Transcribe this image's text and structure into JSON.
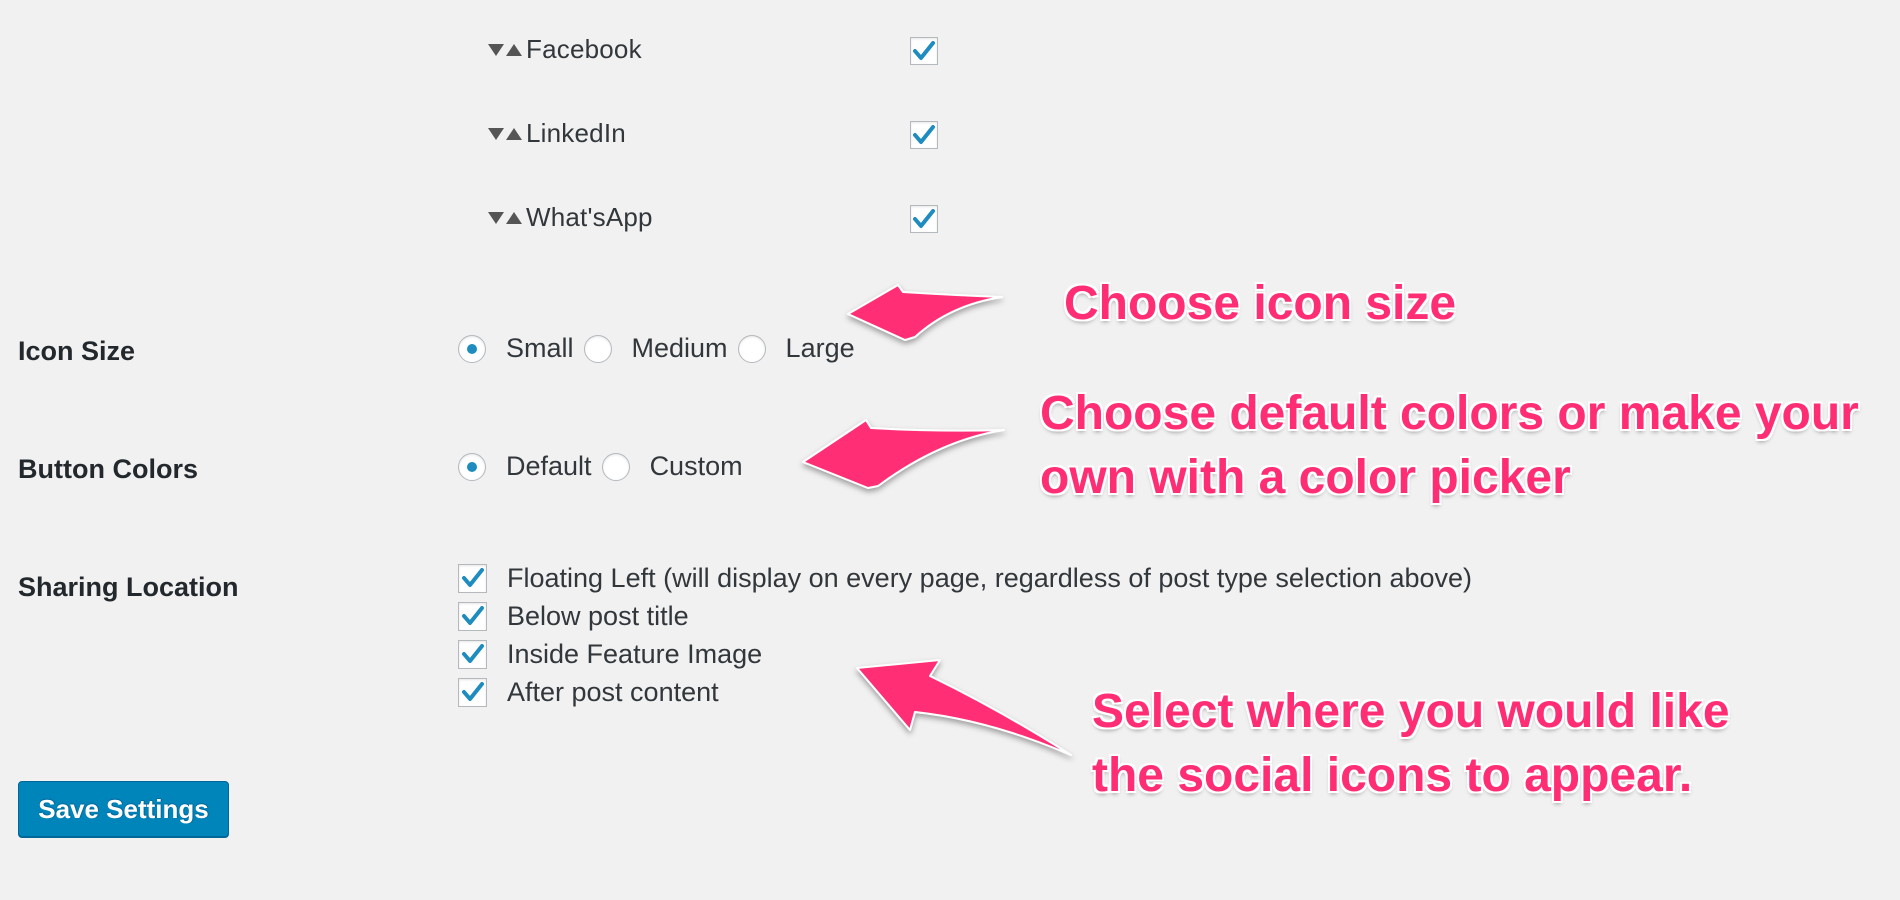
{
  "networks": [
    {
      "label": "Facebook",
      "checked": true
    },
    {
      "label": "LinkedIn",
      "checked": true
    },
    {
      "label": "What'sApp",
      "checked": true
    }
  ],
  "icon_size": {
    "label": "Icon Size",
    "options": [
      "Small",
      "Medium",
      "Large"
    ],
    "selected": "Small"
  },
  "button_colors": {
    "label": "Button Colors",
    "options": [
      "Default",
      "Custom"
    ],
    "selected": "Default"
  },
  "sharing_location": {
    "label": "Sharing Location",
    "options": [
      {
        "label": "Floating Left (will display on every page, regardless of post type selection above)",
        "checked": true
      },
      {
        "label": "Below post title",
        "checked": true
      },
      {
        "label": "Inside Feature Image",
        "checked": true
      },
      {
        "label": "After post content",
        "checked": true
      }
    ]
  },
  "save_button": {
    "label": "Save Settings"
  },
  "annotations": {
    "icon_size": "Choose icon size",
    "colors_line1": "Choose default colors or make your",
    "colors_line2": "own with a color picker",
    "location_line1": "Select where you would like",
    "location_line2": "the social icons to appear."
  },
  "colors": {
    "accent": "#1e8cbe",
    "button": "#0085ba",
    "annotation": "#ff2e74",
    "background": "#f1f1f1"
  }
}
